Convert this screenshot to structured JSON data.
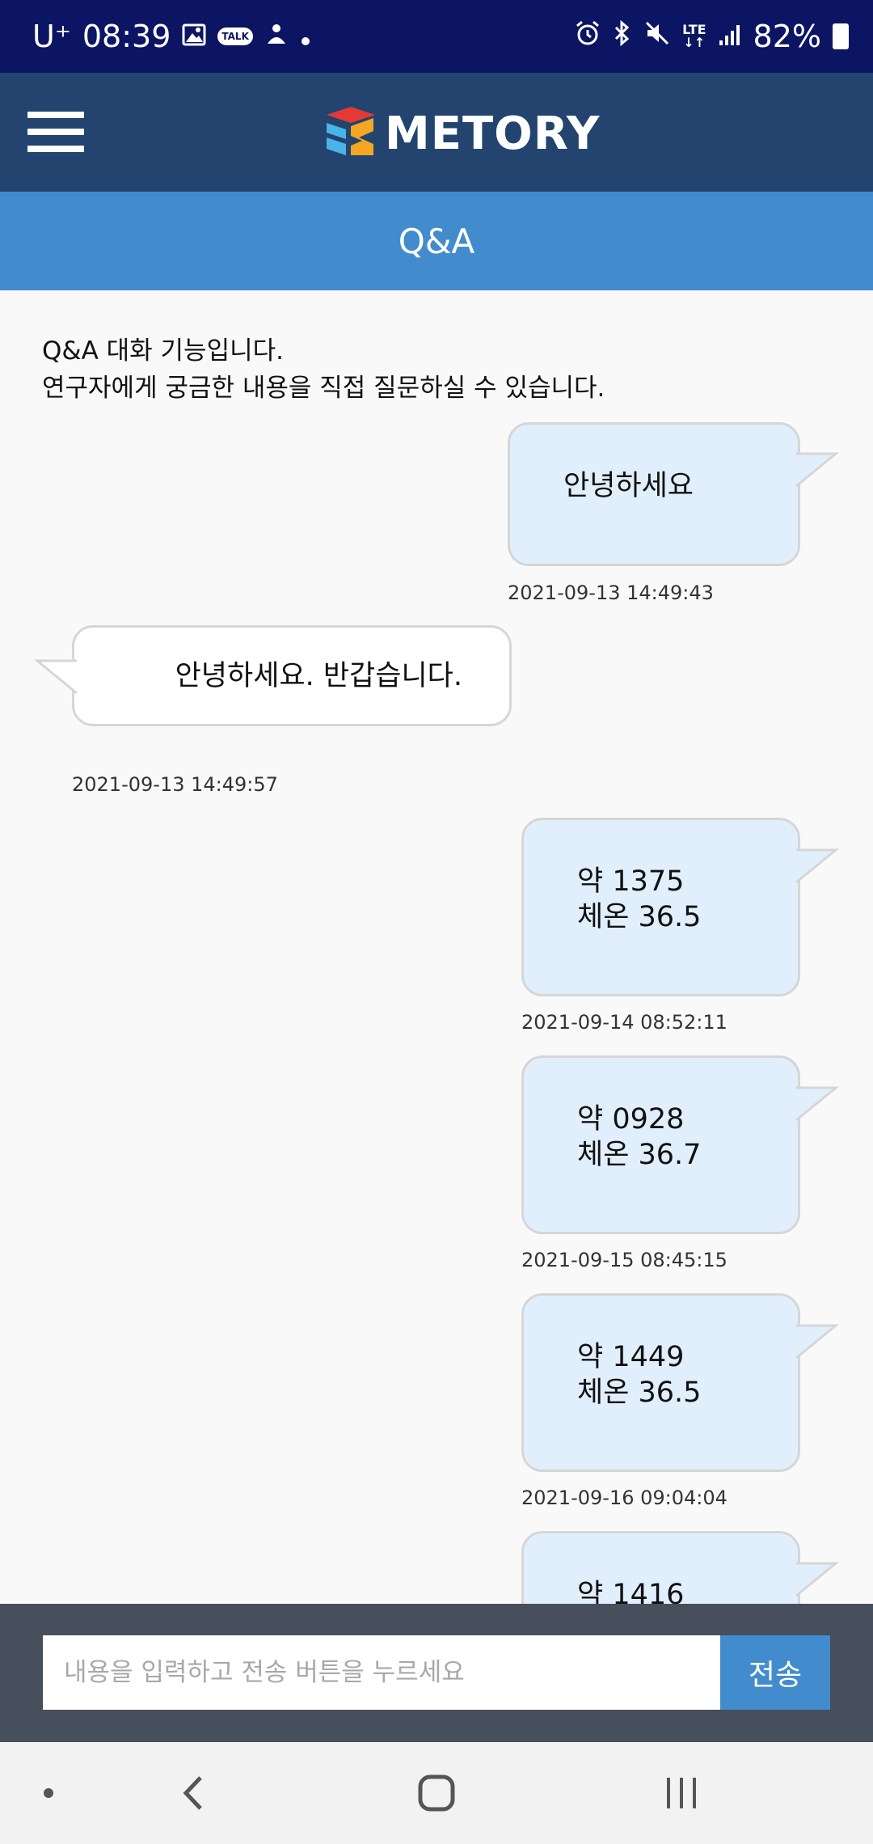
{
  "status_bar": {
    "carrier": "U⁺",
    "time": "08:39",
    "talk_badge": "TALK",
    "network": "LTE",
    "battery": "82%"
  },
  "header": {
    "logo_text": "METORY"
  },
  "title_bar": {
    "title": "Q&A"
  },
  "intro": {
    "line1": "Q&A 대화 기능입니다.",
    "line2": "연구자에게 궁금한 내용을 직접 질문하실 수 있습니다."
  },
  "messages": [
    {
      "sender": "me",
      "lines": [
        "안녕하세요"
      ],
      "timestamp": "2021-09-13 14:49:43"
    },
    {
      "sender": "other",
      "lines": [
        "안녕하세요. 반갑습니다."
      ],
      "timestamp": "2021-09-13 14:49:57"
    },
    {
      "sender": "me",
      "lines": [
        "약 1375",
        "체온 36.5"
      ],
      "timestamp": "2021-09-14 08:52:11"
    },
    {
      "sender": "me",
      "lines": [
        "약 0928",
        "체온 36.7"
      ],
      "timestamp": "2021-09-15 08:45:15"
    },
    {
      "sender": "me",
      "lines": [
        "약 1449",
        "체온 36.5"
      ],
      "timestamp": "2021-09-16 09:04:04"
    },
    {
      "sender": "me",
      "lines": [
        "약 1416"
      ],
      "timestamp": ""
    }
  ],
  "input": {
    "placeholder": "내용을 입력하고 전송 버튼을 누르세요",
    "value": "",
    "send_label": "전송"
  },
  "colors": {
    "status_bar": "#0c1563",
    "header": "#22446f",
    "title_bar": "#428cce",
    "my_bubble": "#e1effc",
    "other_bubble": "#ffffff",
    "input_bar": "#474e5c",
    "send_button": "#428cce"
  }
}
